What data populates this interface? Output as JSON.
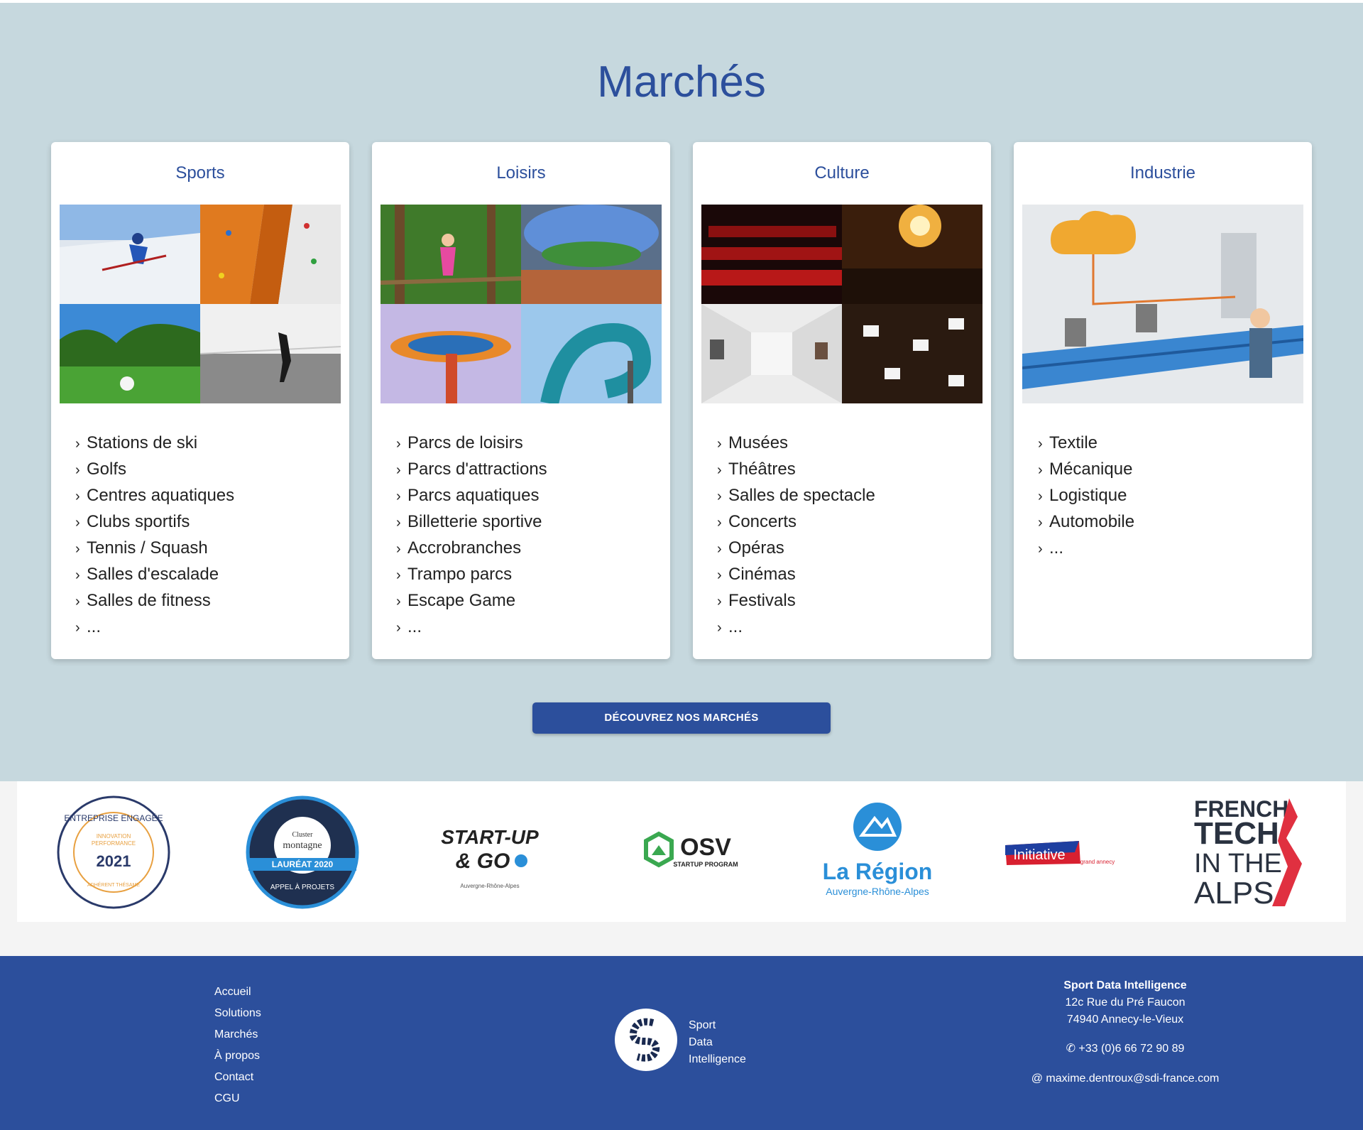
{
  "markets": {
    "title": "Marchés",
    "cta_label": "DÉCOUVREZ NOS MARCHÉS",
    "cards": [
      {
        "title": "Sports",
        "items": [
          "Stations de ski",
          "Golfs",
          "Centres aquatiques",
          "Clubs sportifs",
          "Tennis / Squash",
          "Salles d'escalade",
          "Salles de fitness",
          "..."
        ]
      },
      {
        "title": "Loisirs",
        "items": [
          "Parcs de loisirs",
          "Parcs d'attractions",
          "Parcs aquatiques",
          "Billetterie sportive",
          "Accrobranches",
          "Trampo parcs",
          "Escape Game",
          "..."
        ]
      },
      {
        "title": "Culture",
        "items": [
          "Musées",
          "Théâtres",
          "Salles de spectacle",
          "Concerts",
          "Opéras",
          "Cinémas",
          "Festivals",
          "..."
        ]
      },
      {
        "title": "Industrie",
        "items": [
          "Textile",
          "Mécanique",
          "Logistique",
          "Automobile",
          "..."
        ]
      }
    ]
  },
  "partners": [
    {
      "name": "entreprise-engagee-logo",
      "texts": [
        "ENTREPRISE ENGAGÉE",
        "INNOVATION",
        "PERFORMANCE",
        "2021",
        "ADHÉRENT THÉSAME"
      ]
    },
    {
      "name": "cluster-montagne-logo",
      "texts": [
        "Cluster",
        "montagne",
        "LAURÉAT 2020",
        "APPEL À PROJETS"
      ]
    },
    {
      "name": "startup-and-go-logo",
      "texts": [
        "START-UP",
        "& GO",
        "Auvergne-Rhône-Alpes"
      ]
    },
    {
      "name": "osv-logo",
      "texts": [
        "OSV",
        "STARTUP PROGRAM"
      ]
    },
    {
      "name": "la-region-logo",
      "texts": [
        "La Région",
        "Auvergne-Rhône-Alpes"
      ]
    },
    {
      "name": "initiative-logo",
      "texts": [
        "Initiative",
        "grand annecy"
      ]
    },
    {
      "name": "french-tech-alps-logo",
      "texts": [
        "FRENCH",
        "TECH",
        "IN THE",
        "ALPS"
      ]
    }
  ],
  "footer": {
    "nav": [
      "Accueil",
      "Solutions",
      "Marchés",
      "À propos",
      "Contact",
      "CGU"
    ],
    "brand_lines": [
      "Sport",
      "Data",
      "Intelligence"
    ],
    "company": "Sport Data Intelligence",
    "address_line1": "12c Rue du Pré Faucon",
    "address_line2": "74940 Annecy-le-Vieux",
    "phone": "+33 (0)6 66 72 90 89",
    "email": "maxime.dentroux@sdi-france.com"
  },
  "colors": {
    "brand": "#2c4f9c",
    "section_bg": "#c6d8de"
  },
  "icons": [
    "chevron-right-icon",
    "phone-icon",
    "at-icon",
    "sdi-logo-icon"
  ]
}
